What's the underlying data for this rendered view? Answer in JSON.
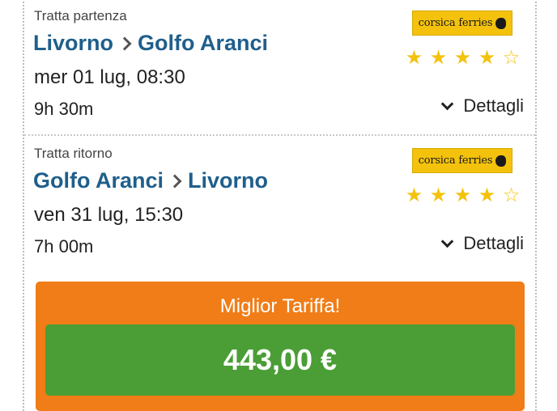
{
  "outbound": {
    "type_label": "Tratta partenza",
    "from": "Livorno",
    "to": "Golfo Aranci",
    "datetime": "mer 01 lug, 08:30",
    "duration": "9h 30m",
    "operator": "corsica ferries",
    "rating": 4,
    "rating_max": 5,
    "details_label": "Dettagli"
  },
  "return": {
    "type_label": "Tratta ritorno",
    "from": "Golfo Aranci",
    "to": "Livorno",
    "datetime": "ven 31 lug, 15:30",
    "duration": "7h 00m",
    "operator": "corsica ferries",
    "rating": 4,
    "rating_max": 5,
    "details_label": "Dettagli"
  },
  "fare": {
    "label": "Miglior Tariffa!",
    "price": "443,00 €"
  },
  "colors": {
    "route_blue": "#1f5f8b",
    "star_yellow": "#f4c20d",
    "fare_orange": "#f07d18",
    "price_green": "#4a9e35",
    "logo_yellow": "#f4c20d"
  }
}
